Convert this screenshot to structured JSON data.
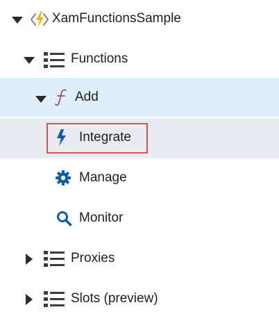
{
  "tree": {
    "root": {
      "label": "XamFunctionsSample",
      "icon": "function-app-icon",
      "expanded": true
    },
    "functions": {
      "label": "Functions",
      "icon": "list-icon",
      "expanded": true
    },
    "add": {
      "label": "Add",
      "icon": "function-icon",
      "expanded": true
    },
    "integrate": {
      "label": "Integrate",
      "icon": "lightning-icon"
    },
    "manage": {
      "label": "Manage",
      "icon": "gear-icon"
    },
    "monitor": {
      "label": "Monitor",
      "icon": "magnifier-icon"
    },
    "proxies": {
      "label": "Proxies",
      "icon": "list-icon",
      "expanded": false
    },
    "slots": {
      "label": "Slots (preview)",
      "icon": "list-icon",
      "expanded": false
    }
  },
  "colors": {
    "selected_bg": "#e1effd",
    "hover_bg": "#e8ebef",
    "accent_blue": "#0b5cad",
    "function_purple": "#8a4fa3",
    "highlight_red": "#d9534f",
    "icon_dark": "#3c3c3c"
  }
}
